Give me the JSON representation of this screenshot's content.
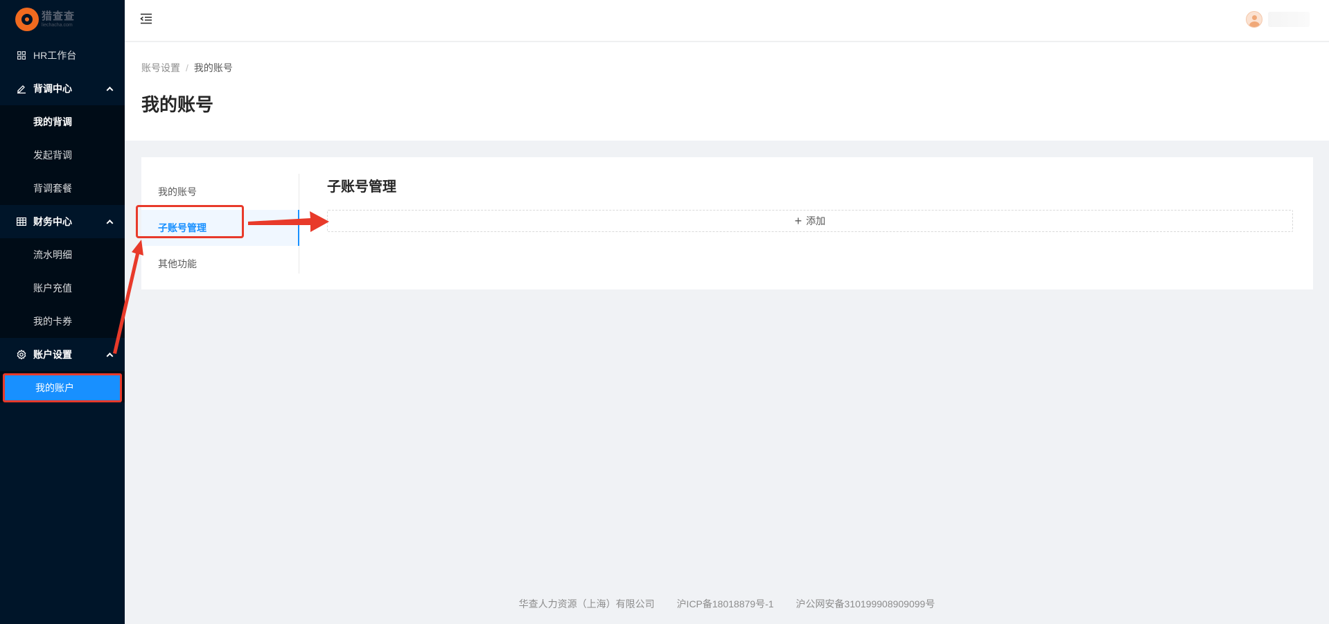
{
  "logo": {
    "name": "猎查查",
    "sub": "liechacha.com"
  },
  "sidebar": {
    "workbench": {
      "label": "HR工作台",
      "icon": "dashboard-icon"
    },
    "groups": [
      {
        "label": "背调中心",
        "icon": "edit-icon",
        "items": [
          "我的背调",
          "发起背调",
          "背调套餐"
        ]
      },
      {
        "label": "财务中心",
        "icon": "table-icon",
        "items": [
          "流水明细",
          "账户充值",
          "我的卡券"
        ]
      },
      {
        "label": "账户设置",
        "icon": "gear-icon",
        "items": [
          "我的账户"
        ]
      }
    ]
  },
  "header": {
    "user_name": ""
  },
  "breadcrumb": {
    "parent": "账号设置",
    "separator": "/",
    "current": "我的账号"
  },
  "page_title": "我的账号",
  "account_menu": {
    "items": [
      "我的账号",
      "子账号管理",
      "其他功能"
    ],
    "active_index": 1
  },
  "content": {
    "title": "子账号管理",
    "add_label": "添加"
  },
  "footer": {
    "company": "华查人力资源（上海）有限公司",
    "icp": "沪ICP备18018879号-1",
    "police": "沪公网安备310199908909099号"
  },
  "colors": {
    "sidebar_bg": "#001529",
    "accent": "#1890ff",
    "annotation": "#e83a2a",
    "logo": "#f06a1f"
  }
}
